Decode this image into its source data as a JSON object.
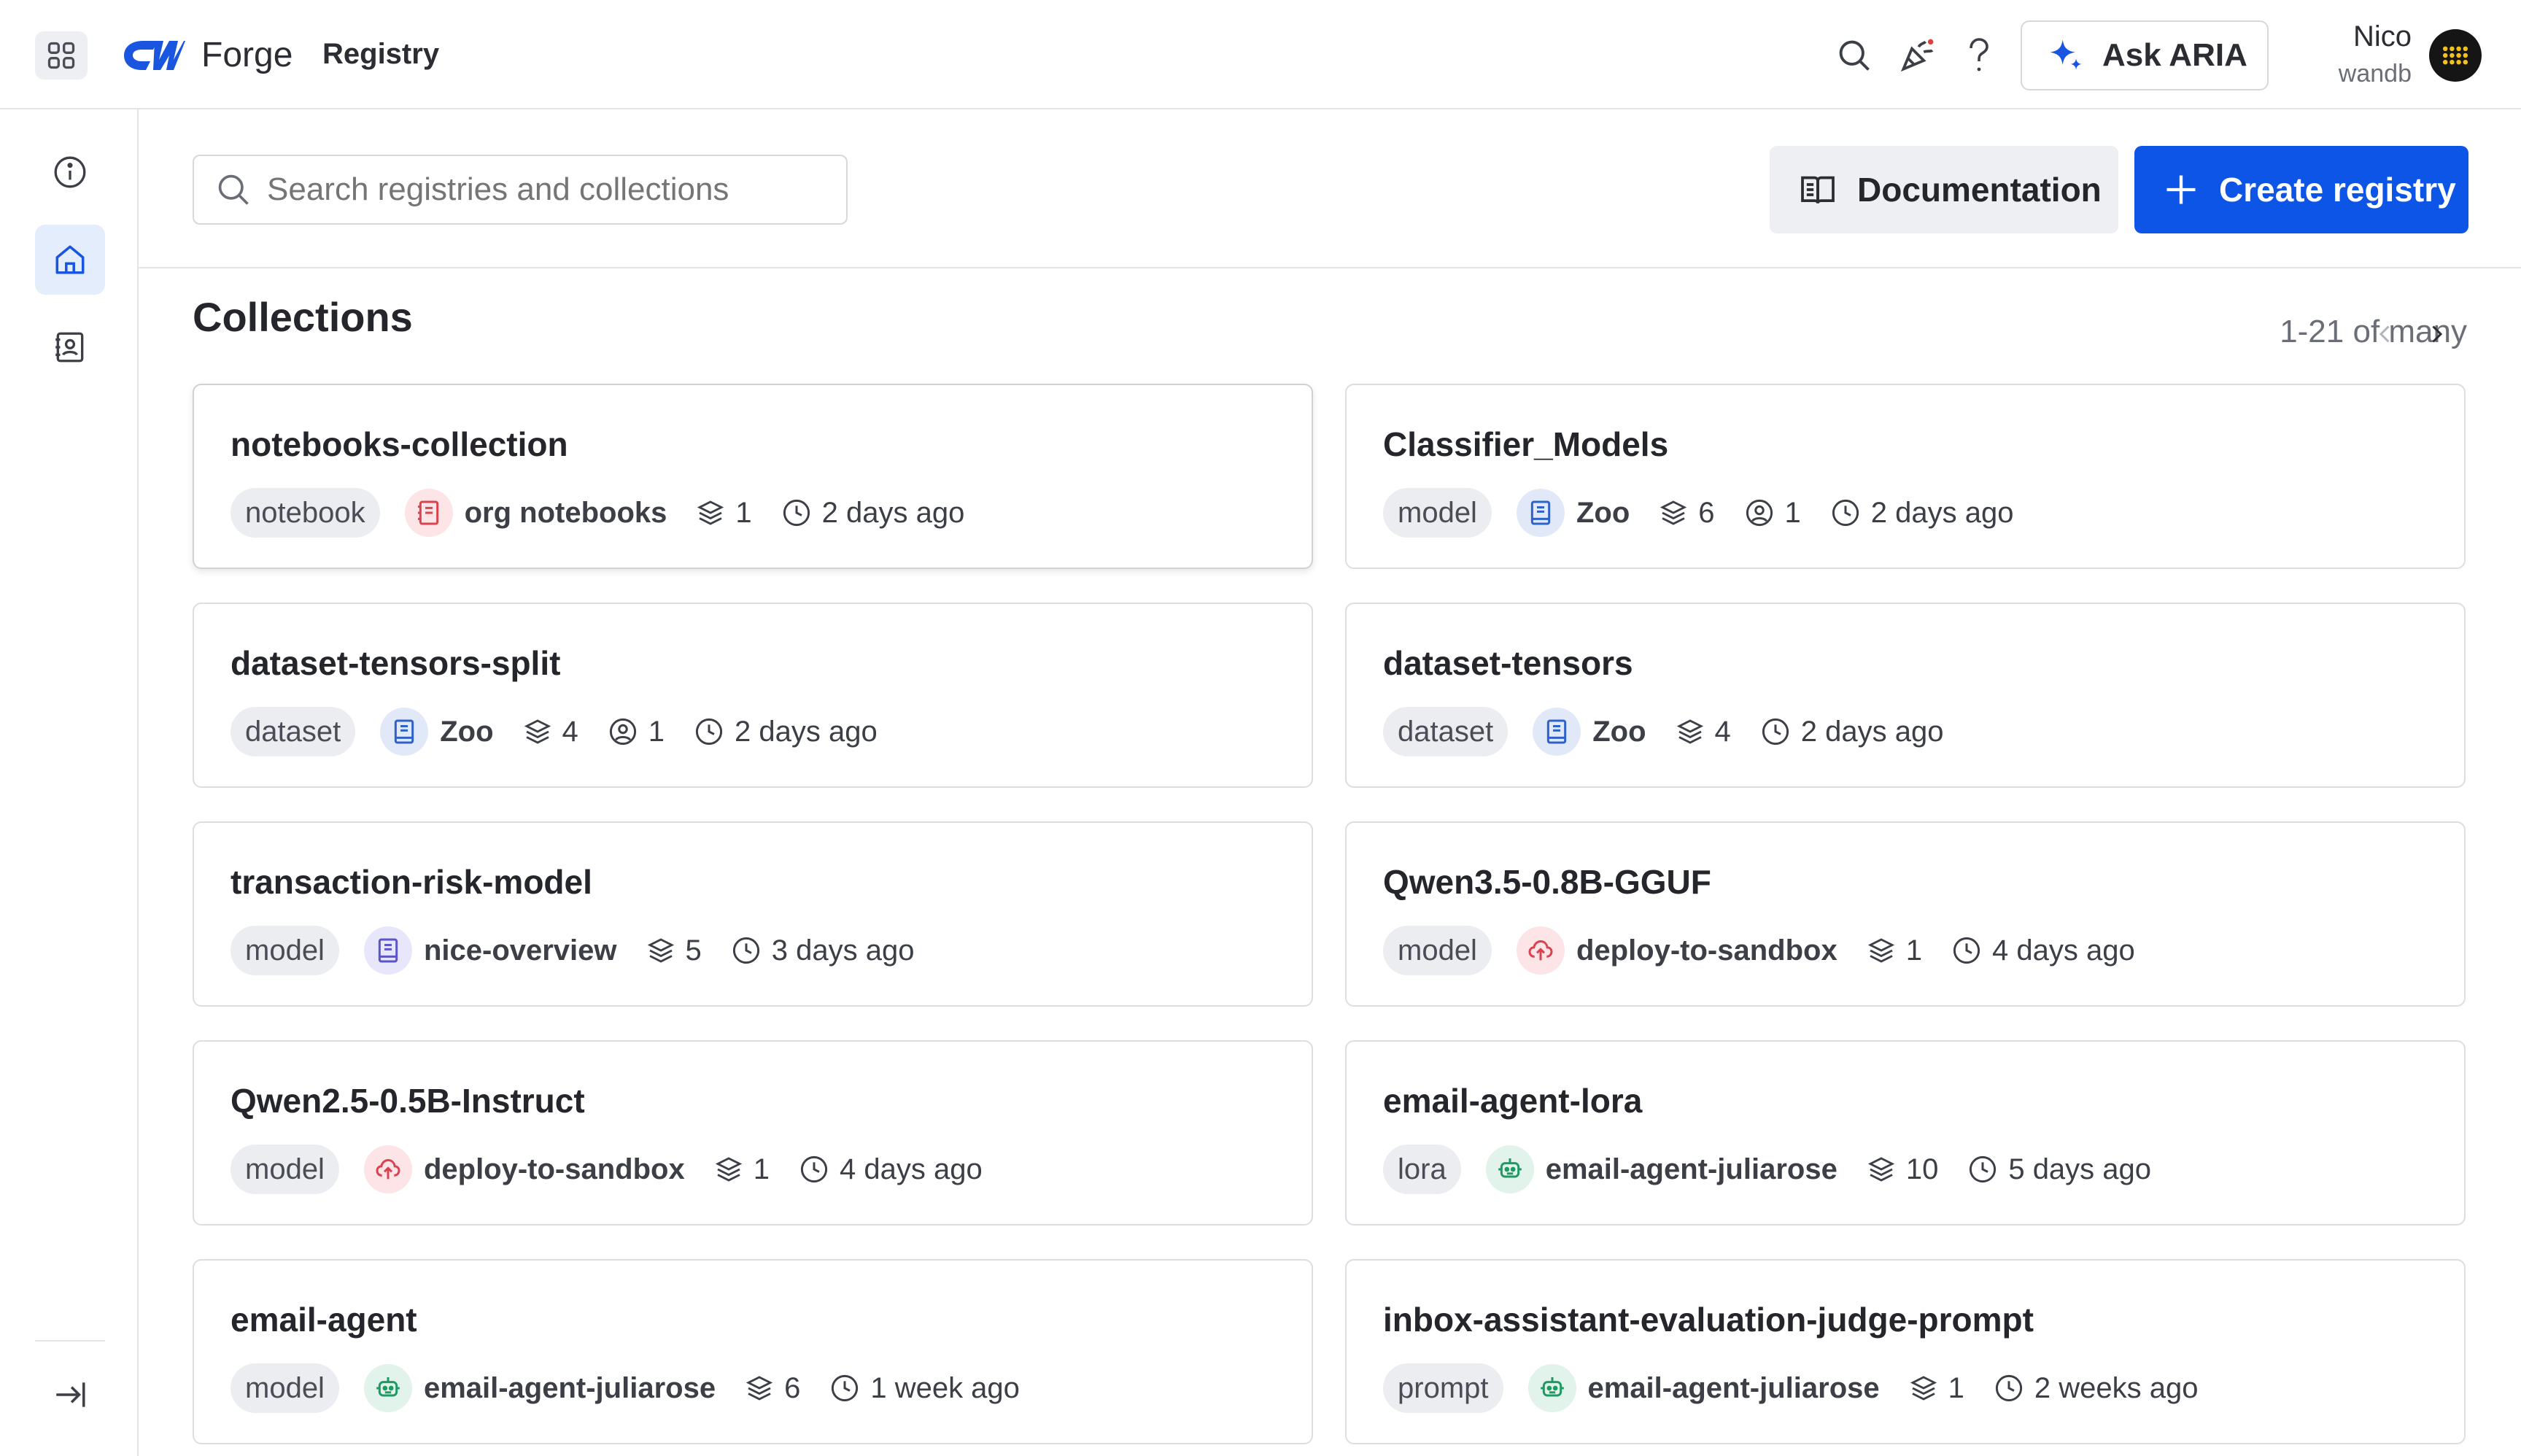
{
  "header": {
    "brand": "Forge",
    "nav_current": "Registry",
    "ask_label": "Ask ARIA",
    "user_name": "Nico",
    "user_org": "wandb"
  },
  "toolbar": {
    "search_placeholder": "Search registries and collections",
    "docs_label": "Documentation",
    "create_label": "Create registry"
  },
  "collections": {
    "title": "Collections",
    "pagination": "1-21 of many",
    "items": [
      {
        "name": "notebooks-collection",
        "type": "notebook",
        "registry": "org notebooks",
        "registry_icon": "notebook-icon",
        "registry_color": "red",
        "versions": "1",
        "users": null,
        "updated": "2 days ago"
      },
      {
        "name": "Classifier_Models",
        "type": "model",
        "registry": "Zoo",
        "registry_icon": "book-icon",
        "registry_color": "blue",
        "versions": "6",
        "users": "1",
        "updated": "2 days ago"
      },
      {
        "name": "dataset-tensors-split",
        "type": "dataset",
        "registry": "Zoo",
        "registry_icon": "book-icon",
        "registry_color": "blue",
        "versions": "4",
        "users": "1",
        "updated": "2 days ago"
      },
      {
        "name": "dataset-tensors",
        "type": "dataset",
        "registry": "Zoo",
        "registry_icon": "book-icon",
        "registry_color": "blue",
        "versions": "4",
        "users": null,
        "updated": "2 days ago"
      },
      {
        "name": "transaction-risk-model",
        "type": "model",
        "registry": "nice-overview",
        "registry_icon": "book-icon",
        "registry_color": "violet",
        "versions": "5",
        "users": null,
        "updated": "3 days ago"
      },
      {
        "name": "Qwen3.5-0.8B-GGUF",
        "type": "model",
        "registry": "deploy-to-sandbox",
        "registry_icon": "cloud-upload-icon",
        "registry_color": "red",
        "versions": "1",
        "users": null,
        "updated": "4 days ago"
      },
      {
        "name": "Qwen2.5-0.5B-Instruct",
        "type": "model",
        "registry": "deploy-to-sandbox",
        "registry_icon": "cloud-upload-icon",
        "registry_color": "red",
        "versions": "1",
        "users": null,
        "updated": "4 days ago"
      },
      {
        "name": "email-agent-lora",
        "type": "lora",
        "registry": "email-agent-juliarose",
        "registry_icon": "robot-icon",
        "registry_color": "green",
        "versions": "10",
        "users": null,
        "updated": "5 days ago"
      },
      {
        "name": "email-agent",
        "type": "model",
        "registry": "email-agent-juliarose",
        "registry_icon": "robot-icon",
        "registry_color": "green",
        "versions": "6",
        "users": null,
        "updated": "1 week ago"
      },
      {
        "name": "inbox-assistant-evaluation-judge-prompt",
        "type": "prompt",
        "registry": "email-agent-juliarose",
        "registry_icon": "robot-icon",
        "registry_color": "green",
        "versions": "1",
        "users": null,
        "updated": "2 weeks ago"
      }
    ]
  },
  "colors": {
    "primary": "#0d55e6",
    "active_nav_bg": "#e4edfb",
    "chip_bg": "#ecedf0",
    "red_icon": "#d9434f",
    "blue_icon": "#2f62c8",
    "violet_icon": "#5b55c7",
    "green_icon": "#1f9a62"
  }
}
